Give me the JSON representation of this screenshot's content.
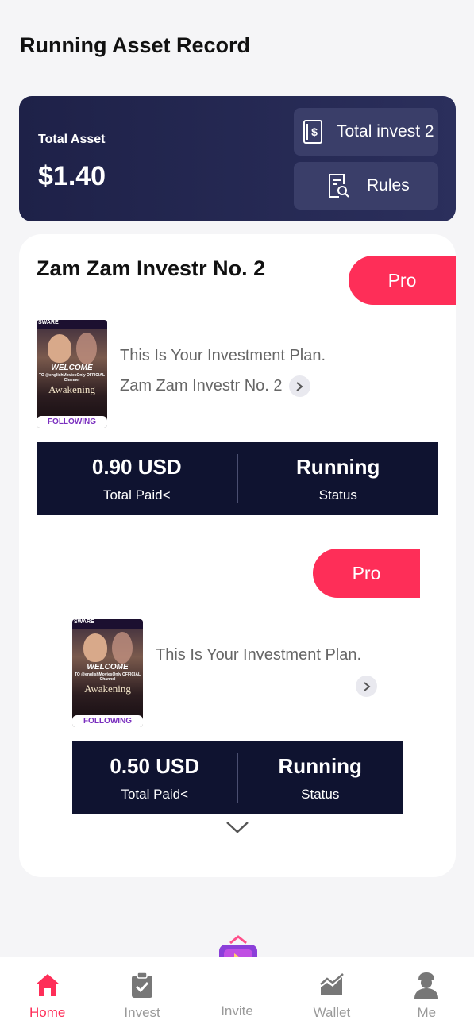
{
  "header": {
    "title": "Running Asset Record"
  },
  "asset": {
    "label": "Total Asset",
    "value": "$1.40",
    "invest_button": "Total invest 2",
    "rules_button": "Rules"
  },
  "plan": {
    "title": "Zam Zam Investr No. 2",
    "items": [
      {
        "tag": "Pro",
        "description": "This Is Your Investment Plan.",
        "name": "Zam Zam Investr No. 2",
        "total_paid_value": "0.90 USD",
        "total_paid_label": "Total Paid<",
        "status_value": "Running",
        "status_label": "Status"
      },
      {
        "tag": "Pro",
        "description": "This Is Your Investment Plan.",
        "name": "",
        "total_paid_value": "0.50 USD",
        "total_paid_label": "Total Paid<",
        "status_value": "Running",
        "status_label": "Status"
      }
    ],
    "poster": {
      "top_text": "SWARE",
      "welcome": "WELCOME",
      "sub": "TO @englishMoviesOnly OFFICIAL Channel",
      "title": "Awakening",
      "following": "FOLLOWING"
    }
  },
  "tabbar": {
    "items": [
      {
        "label": "Home",
        "icon": "home-icon",
        "active": true
      },
      {
        "label": "Invest",
        "icon": "clipboard-check-icon",
        "active": false
      },
      {
        "label": "Invite",
        "icon": "gift-box-icon",
        "active": false
      },
      {
        "label": "Wallet",
        "icon": "chart-icon",
        "active": false
      },
      {
        "label": "Me",
        "icon": "user-icon",
        "active": false
      }
    ]
  },
  "colors": {
    "accent": "#fe2e58",
    "dark_card": "#1e2148",
    "stat_bg": "#0f1330"
  }
}
